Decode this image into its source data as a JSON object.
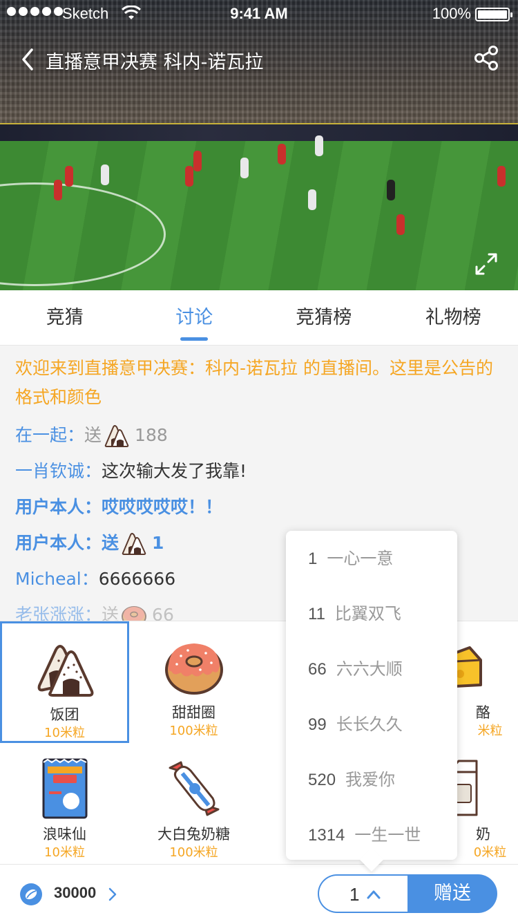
{
  "status_bar": {
    "carrier": "Sketch",
    "time": "9:41 AM",
    "battery": "100%"
  },
  "header": {
    "title": "直播意甲决赛 科内-诺瓦拉"
  },
  "tabs": [
    {
      "label": "竞猜",
      "active": false
    },
    {
      "label": "讨论",
      "active": true
    },
    {
      "label": "竞猜榜",
      "active": false
    },
    {
      "label": "礼物榜",
      "active": false
    }
  ],
  "chat": {
    "notice": "欢迎来到直播意甲决赛：科内-诺瓦拉 的直播间。这里是公告的格式和颜色",
    "messages": [
      {
        "name": "在一起",
        "sep": "：",
        "gift_label": "送",
        "gift_icon": "rice-ball-icon",
        "count": "188"
      },
      {
        "name": "一肖钦诚",
        "sep": "：",
        "text": "这次输大发了我靠!"
      },
      {
        "name": "用户本人",
        "sep": "：",
        "text": "哎哎哎哎哎！！"
      },
      {
        "name": "用户本人",
        "sep": "：",
        "gift_label": "送",
        "gift_icon": "rice-ball-icon",
        "count": "1"
      },
      {
        "name": "Micheal",
        "sep": "：",
        "text": "6666666"
      },
      {
        "name": "老张涨涨",
        "sep": "：",
        "gift_label": "送",
        "gift_icon": "donut-icon",
        "count": "66"
      }
    ]
  },
  "gifts": [
    {
      "name": "饭团",
      "price": "10米粒",
      "icon": "rice-ball-icon",
      "selected": true
    },
    {
      "name": "甜甜圈",
      "price": "100米粒",
      "icon": "donut-icon",
      "selected": false
    },
    {
      "name": "浪味仙",
      "price": "10米粒",
      "icon": "snack-bag-icon",
      "selected": false
    },
    {
      "name": "大白兔奶糖",
      "price": "100米粒",
      "icon": "candy-icon",
      "selected": false
    }
  ],
  "gifts_partial": [
    {
      "name_fragment": "酪",
      "price_fragment": "米粒",
      "icon": "cheese-icon"
    },
    {
      "name_fragment": "奶",
      "price_fragment": "0米粒",
      "icon": "milk-carton-icon"
    }
  ],
  "quantity_menu": [
    {
      "num": "1",
      "label": "一心一意"
    },
    {
      "num": "11",
      "label": "比翼双飞"
    },
    {
      "num": "66",
      "label": "六六大顺"
    },
    {
      "num": "99",
      "label": "长长久久"
    },
    {
      "num": "520",
      "label": "我爱你"
    },
    {
      "num": "1314",
      "label": "一生一世"
    }
  ],
  "bottom": {
    "balance": "30000",
    "quantity": "1",
    "send_label": "赠送"
  },
  "colors": {
    "accent": "#4a90e2",
    "notice": "#f5a623",
    "price": "#f5a623"
  }
}
